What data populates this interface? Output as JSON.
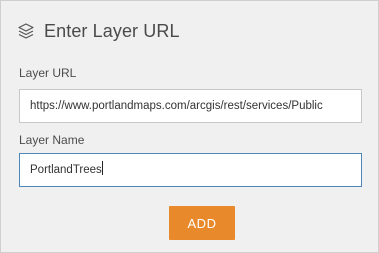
{
  "dialog": {
    "title": "Enter Layer URL",
    "icon": "layers-icon"
  },
  "url_field": {
    "label": "Layer URL",
    "value": "https://www.portlandmaps.com/arcgis/rest/services/Public"
  },
  "name_field": {
    "label": "Layer Name",
    "value": "PortlandTrees"
  },
  "actions": {
    "add_label": "ADD"
  },
  "colors": {
    "accent": "#e8892b",
    "focus_border": "#4d86b8"
  }
}
